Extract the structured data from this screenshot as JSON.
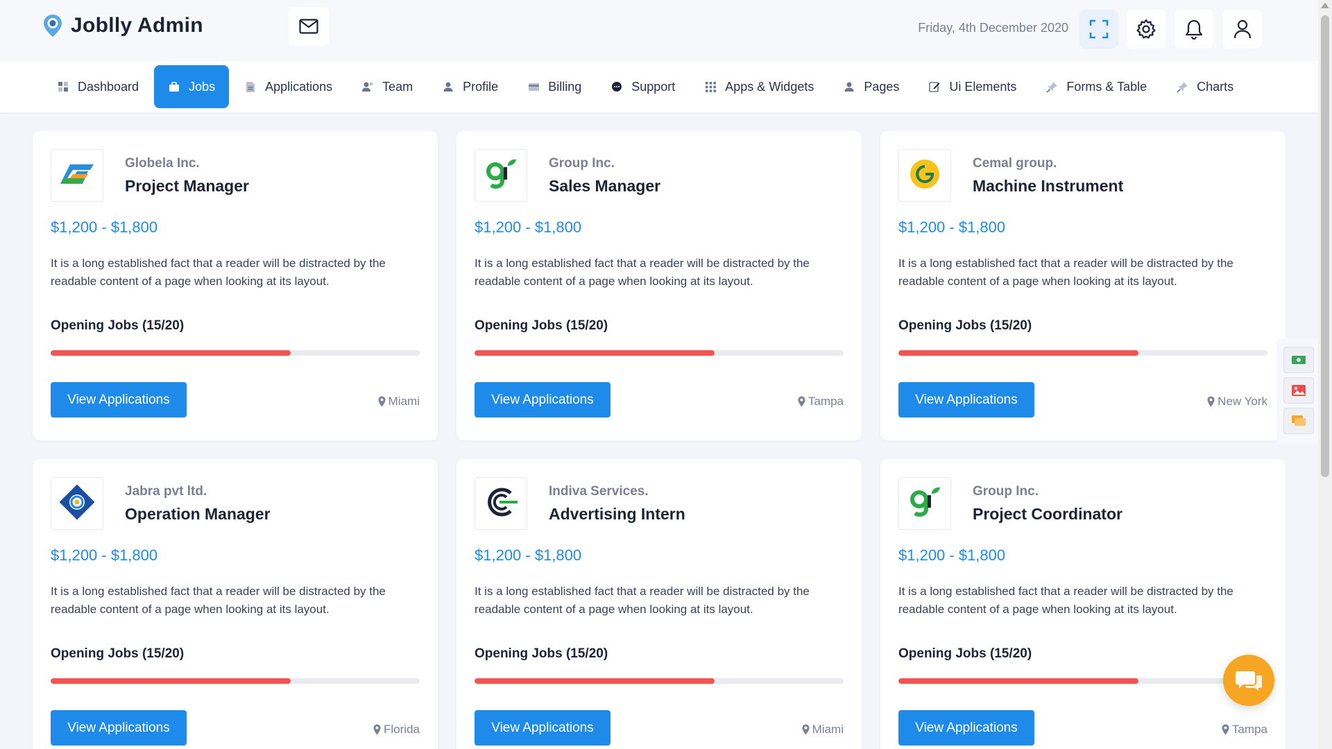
{
  "app": {
    "title": "Joblly Admin"
  },
  "header": {
    "date": "Friday, 4th December 2020"
  },
  "nav": [
    {
      "label": "Dashboard",
      "icon": "grid-icon"
    },
    {
      "label": "Jobs",
      "icon": "briefcase-icon",
      "active": true
    },
    {
      "label": "Applications",
      "icon": "document-icon"
    },
    {
      "label": "Team",
      "icon": "team-icon"
    },
    {
      "label": "Profile",
      "icon": "user-icon"
    },
    {
      "label": "Billing",
      "icon": "credit-card-icon"
    },
    {
      "label": "Support",
      "icon": "chat-bubble-icon"
    },
    {
      "label": "Apps & Widgets",
      "icon": "apps-grid-icon"
    },
    {
      "label": "Pages",
      "icon": "user-icon"
    },
    {
      "label": "Ui Elements",
      "icon": "edit-icon"
    },
    {
      "label": "Forms & Table",
      "icon": "pin-icon"
    },
    {
      "label": "Charts",
      "icon": "pin-icon"
    }
  ],
  "jobs": [
    {
      "company": "Globela Inc.",
      "role": "Project Manager",
      "salary": "$1,200 - $1,800",
      "description": "It is a long established fact that a reader will be distracted by the readable content of a page when looking at its layout.",
      "openings": "Opening Jobs (15/20)",
      "progress": 0.65,
      "button": "View Applications",
      "location": "Miami",
      "logo": "globela-logo"
    },
    {
      "company": "Group Inc.",
      "role": "Sales Manager",
      "salary": "$1,200 - $1,800",
      "description": "It is a long established fact that a reader will be distracted by the readable content of a page when looking at its layout.",
      "openings": "Opening Jobs (15/20)",
      "progress": 0.65,
      "button": "View Applications",
      "location": "Tampa",
      "logo": "group-logo"
    },
    {
      "company": "Cemal group.",
      "role": "Machine Instrument",
      "salary": "$1,200 - $1,800",
      "description": "It is a long established fact that a reader will be distracted by the readable content of a page when looking at its layout.",
      "openings": "Opening Jobs (15/20)",
      "progress": 0.65,
      "button": "View Applications",
      "location": "New York",
      "logo": "cemal-logo"
    },
    {
      "company": "Jabra pvt ltd.",
      "role": "Operation Manager",
      "salary": "$1,200 - $1,800",
      "description": "It is a long established fact that a reader will be distracted by the readable content of a page when looking at its layout.",
      "openings": "Opening Jobs (15/20)",
      "progress": 0.65,
      "button": "View Applications",
      "location": "Florida",
      "logo": "jabra-logo"
    },
    {
      "company": "Indiva Services.",
      "role": "Advertising Intern",
      "salary": "$1,200 - $1,800",
      "description": "It is a long established fact that a reader will be distracted by the readable content of a page when looking at its layout.",
      "openings": "Opening Jobs (15/20)",
      "progress": 0.65,
      "button": "View Applications",
      "location": "Miami",
      "logo": "indiva-logo"
    },
    {
      "company": "Group Inc.",
      "role": "Project Coordinator",
      "salary": "$1,200 - $1,800",
      "description": "It is a long established fact that a reader will be distracted by the readable content of a page when looking at its layout.",
      "openings": "Opening Jobs (15/20)",
      "progress": 0.65,
      "button": "View Applications",
      "location": "Tampa",
      "logo": "group-logo"
    }
  ],
  "colors": {
    "accent": "#1e8bea",
    "progress": "#f25353",
    "chat": "#f6a623"
  }
}
